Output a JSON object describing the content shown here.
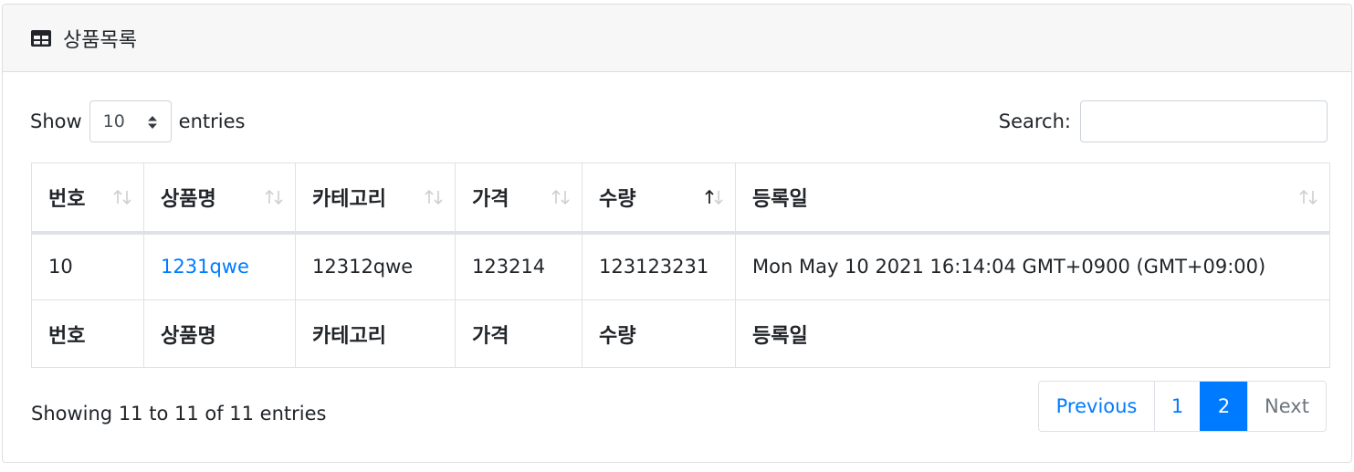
{
  "card": {
    "title": "상품목록",
    "icon": "table-icon"
  },
  "length": {
    "label_before": "Show",
    "selected": "10",
    "label_after": "entries"
  },
  "search": {
    "label": "Search:",
    "value": ""
  },
  "table": {
    "columns": [
      "번호",
      "상품명",
      "카테고리",
      "가격",
      "수량",
      "등록일"
    ],
    "rows": [
      {
        "no": "10",
        "name": "1231qwe",
        "category": "12312qwe",
        "price": "123214",
        "qty": "123123231",
        "date": "Mon May 10 2021 16:14:04 GMT+0900 (GMT+09:00)"
      }
    ],
    "sorted_column": "수량",
    "sort_direction": "asc"
  },
  "info": "Showing 11 to 11 of 11 entries",
  "pagination": {
    "previous": "Previous",
    "pages": [
      "1",
      "2"
    ],
    "current": "2",
    "next": "Next"
  },
  "colors": {
    "link": "#007bff",
    "active_page_bg": "#007bff",
    "disabled": "#6c757d"
  }
}
